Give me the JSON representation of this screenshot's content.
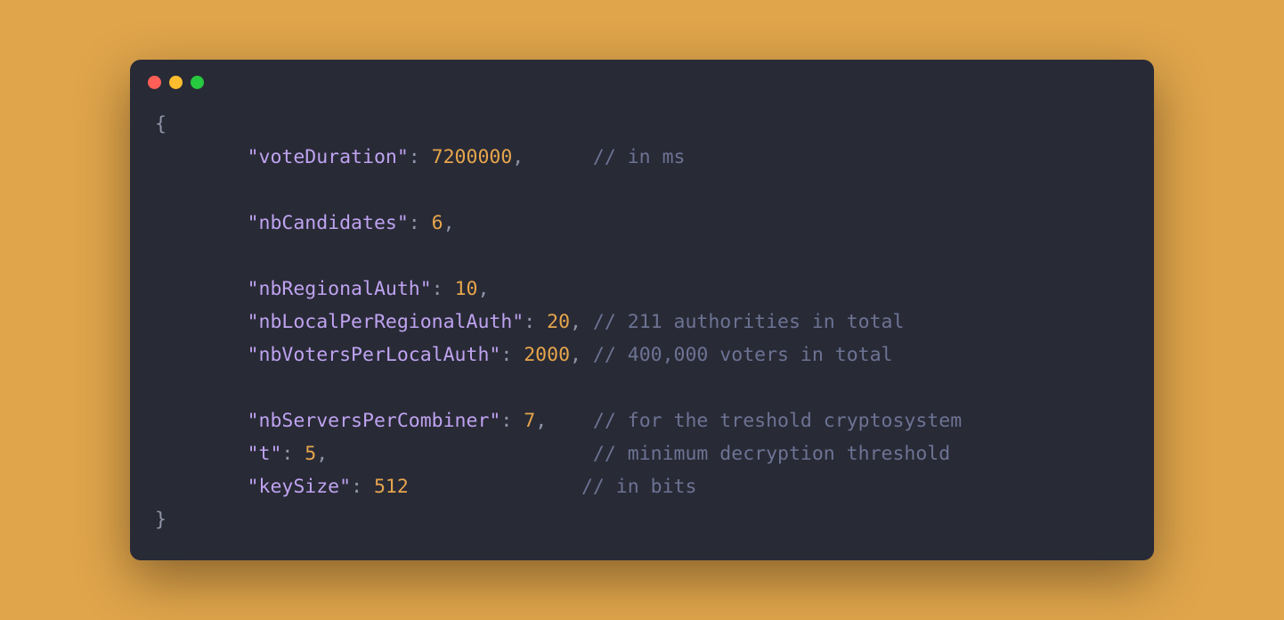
{
  "window": {
    "traffic_lights": [
      "red",
      "yellow",
      "green"
    ]
  },
  "code": {
    "open_brace": "{",
    "close_brace": "}",
    "lines": [
      {
        "indent": "        ",
        "key": "\"voteDuration\"",
        "colon": ": ",
        "value": "7200000",
        "comma": ",",
        "pad": "      ",
        "comment": "// in ms"
      },
      {
        "blank": true
      },
      {
        "indent": "        ",
        "key": "\"nbCandidates\"",
        "colon": ": ",
        "value": "6",
        "comma": ",",
        "pad": "",
        "comment": ""
      },
      {
        "blank": true
      },
      {
        "indent": "        ",
        "key": "\"nbRegionalAuth\"",
        "colon": ": ",
        "value": "10",
        "comma": ",",
        "pad": "",
        "comment": ""
      },
      {
        "indent": "        ",
        "key": "\"nbLocalPerRegionalAuth\"",
        "colon": ": ",
        "value": "20",
        "comma": ",",
        "pad": " ",
        "comment": "// 211 authorities in total"
      },
      {
        "indent": "        ",
        "key": "\"nbVotersPerLocalAuth\"",
        "colon": ": ",
        "value": "2000",
        "comma": ",",
        "pad": " ",
        "comment": "// 400,000 voters in total"
      },
      {
        "blank": true
      },
      {
        "indent": "        ",
        "key": "\"nbServersPerCombiner\"",
        "colon": ": ",
        "value": "7",
        "comma": ",",
        "pad": "    ",
        "comment": "// for the treshold cryptosystem"
      },
      {
        "indent": "        ",
        "key": "\"t\"",
        "colon": ": ",
        "value": "5",
        "comma": ",",
        "pad": "                       ",
        "comment": "// minimum decryption threshold"
      },
      {
        "indent": "        ",
        "key": "\"keySize\"",
        "colon": ": ",
        "value": "512",
        "comma": "",
        "pad": "               ",
        "comment": "// in bits"
      }
    ]
  }
}
